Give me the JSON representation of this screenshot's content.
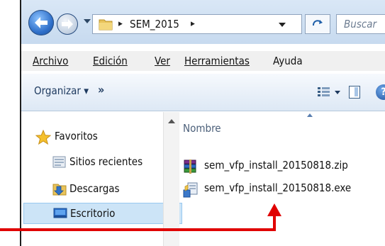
{
  "address": {
    "breadcrumb": "SEM_2015",
    "separator": "▸",
    "search_placeholder": "Buscar"
  },
  "menubar": {
    "items": [
      {
        "label": "Archivo"
      },
      {
        "label": "Edición"
      },
      {
        "label": "Ver"
      },
      {
        "label": "Herramientas"
      },
      {
        "label": "Ayuda"
      }
    ]
  },
  "cmdbar": {
    "organize_label": "Organizar ▾",
    "more_label": "»",
    "help_label": "?"
  },
  "navpane": {
    "items": [
      {
        "label": "Favoritos",
        "icon": "star-icon"
      },
      {
        "label": "Sitios recientes",
        "icon": "recent-places-icon"
      },
      {
        "label": "Descargas",
        "icon": "downloads-folder-icon"
      },
      {
        "label": "Escritorio",
        "icon": "desktop-icon",
        "selected": true
      }
    ]
  },
  "content": {
    "column_header": "Nombre",
    "files": [
      {
        "name": "sem_vfp_install_20150818.zip",
        "icon": "winrar-archive-icon"
      },
      {
        "name": "sem_vfp_install_20150818.exe",
        "icon": "installer-exe-icon"
      }
    ]
  },
  "colors": {
    "annotation": "#e00000",
    "selection": "#cce4f7"
  }
}
